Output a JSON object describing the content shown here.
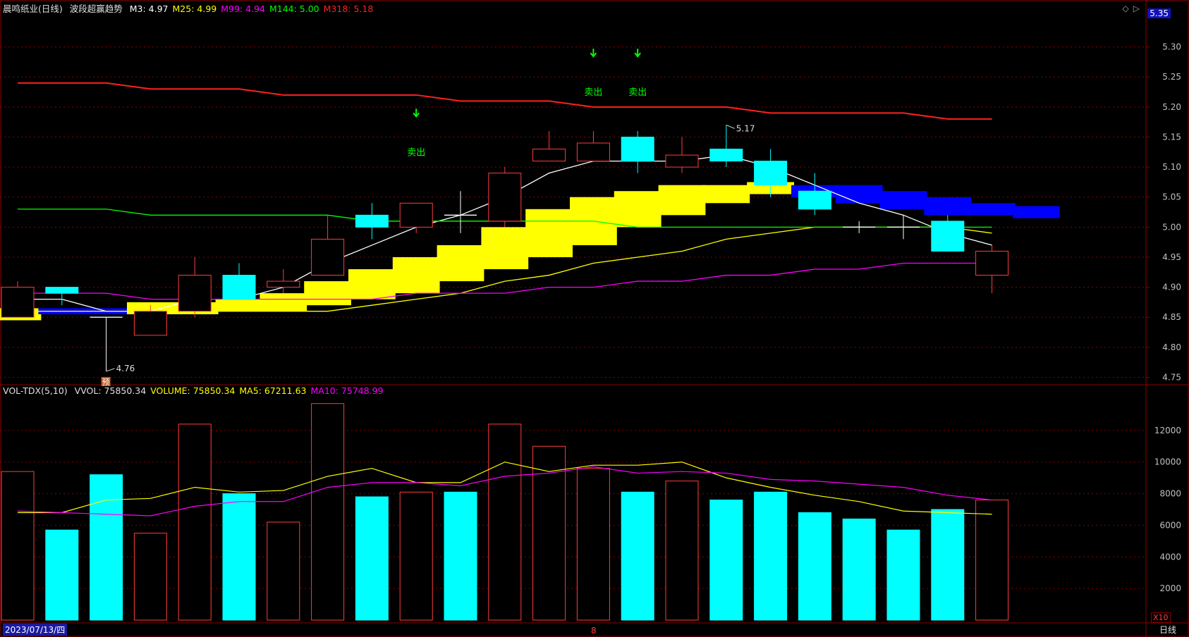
{
  "header_price": {
    "stock": "晨鸣纸业(日线)",
    "indicator": "波段超赢趋势",
    "ma": [
      {
        "label": "M3:",
        "value": "4.97",
        "color": "#ffffff"
      },
      {
        "label": "M25:",
        "value": "4.99",
        "color": "#ffff00"
      },
      {
        "label": "M99:",
        "value": "4.94",
        "color": "#ff00ff"
      },
      {
        "label": "M144:",
        "value": "5.00",
        "color": "#00ff00"
      },
      {
        "label": "M318:",
        "value": "5.18",
        "color": "#ff2020"
      }
    ]
  },
  "header_vol": {
    "name": "VOL-TDX(5,10)",
    "items": [
      {
        "label": "VVOL:",
        "value": "75850.34",
        "color": "#e0e0e0"
      },
      {
        "label": "VOLUME:",
        "value": "75850.34",
        "color": "#ffff00"
      },
      {
        "label": "MA5:",
        "value": "67211.63",
        "color": "#ffff00"
      },
      {
        "label": "MA10:",
        "value": "75748.99",
        "color": "#ff00ff"
      }
    ]
  },
  "axis_top_value": "5.35",
  "vol_unit": "X10",
  "date_label": "2023/07/13/四",
  "period_label": "日线",
  "bottom_marker": "8",
  "high_label": "5.17",
  "low_label": "4.76",
  "pre_label": "预",
  "sell_label": "卖出",
  "colors": {
    "up": "#ff3c3c",
    "down": "#00ffff",
    "m3": "#ffffff",
    "m25": "#ffff00",
    "m99": "#ff00ff",
    "m144": "#00ff00",
    "m318": "#ff2020",
    "band_up": "#ffff00",
    "band_down": "#0000ff",
    "grid": "#8b0000",
    "axis": "#c0c0c0",
    "sell": "#00ff00"
  },
  "chart_data": [
    {
      "type": "candlestick",
      "title": "晨鸣纸业(日线)",
      "ylim": [
        4.74,
        5.35
      ],
      "y_ticks": [
        4.75,
        4.8,
        4.85,
        4.9,
        4.95,
        5.0,
        5.05,
        5.1,
        5.15,
        5.2,
        5.25,
        5.3
      ],
      "candles": [
        {
          "o": 4.85,
          "h": 4.91,
          "l": 4.85,
          "c": 4.9
        },
        {
          "o": 4.9,
          "h": 4.9,
          "l": 4.87,
          "c": 4.89
        },
        {
          "o": 4.85,
          "h": 4.85,
          "l": 4.76,
          "c": 4.85
        },
        {
          "o": 4.82,
          "h": 4.87,
          "l": 4.82,
          "c": 4.86
        },
        {
          "o": 4.86,
          "h": 4.95,
          "l": 4.85,
          "c": 4.92
        },
        {
          "o": 4.92,
          "h": 4.94,
          "l": 4.88,
          "c": 4.88
        },
        {
          "o": 4.9,
          "h": 4.93,
          "l": 4.89,
          "c": 4.91
        },
        {
          "o": 4.92,
          "h": 5.02,
          "l": 4.92,
          "c": 4.98
        },
        {
          "o": 5.02,
          "h": 5.04,
          "l": 4.98,
          "c": 5.0
        },
        {
          "o": 5.0,
          "h": 5.04,
          "l": 4.99,
          "c": 5.04
        },
        {
          "o": 5.02,
          "h": 5.06,
          "l": 4.99,
          "c": 5.02
        },
        {
          "o": 5.01,
          "h": 5.1,
          "l": 5.0,
          "c": 5.09
        },
        {
          "o": 5.11,
          "h": 5.16,
          "l": 5.11,
          "c": 5.13
        },
        {
          "o": 5.11,
          "h": 5.16,
          "l": 5.11,
          "c": 5.14
        },
        {
          "o": 5.15,
          "h": 5.16,
          "l": 5.09,
          "c": 5.11
        },
        {
          "o": 5.1,
          "h": 5.15,
          "l": 5.09,
          "c": 5.12
        },
        {
          "o": 5.13,
          "h": 5.17,
          "l": 5.1,
          "c": 5.11
        },
        {
          "o": 5.11,
          "h": 5.13,
          "l": 5.05,
          "c": 5.07
        },
        {
          "o": 5.06,
          "h": 5.09,
          "l": 5.02,
          "c": 5.03
        },
        {
          "o": 5.0,
          "h": 5.01,
          "l": 4.99,
          "c": 5.0
        },
        {
          "o": 5.0,
          "h": 5.02,
          "l": 4.98,
          "c": 5.0
        },
        {
          "o": 5.01,
          "h": 5.02,
          "l": 4.96,
          "c": 4.96
        },
        {
          "o": 4.92,
          "h": 4.97,
          "l": 4.89,
          "c": 4.96
        }
      ],
      "ma_series": {
        "M3": [
          4.88,
          4.88,
          4.86,
          4.86,
          4.88,
          4.88,
          4.9,
          4.94,
          4.97,
          5.0,
          5.02,
          5.05,
          5.09,
          5.11,
          5.11,
          5.11,
          5.12,
          5.1,
          5.07,
          5.04,
          5.02,
          4.99,
          4.97
        ],
        "M25": [
          4.86,
          4.86,
          4.86,
          4.86,
          4.86,
          4.86,
          4.86,
          4.86,
          4.87,
          4.88,
          4.89,
          4.91,
          4.92,
          4.94,
          4.95,
          4.96,
          4.98,
          4.99,
          5.0,
          5.0,
          5.0,
          5.0,
          4.99
        ],
        "M99": [
          4.89,
          4.89,
          4.89,
          4.88,
          4.88,
          4.88,
          4.88,
          4.88,
          4.88,
          4.89,
          4.89,
          4.89,
          4.9,
          4.9,
          4.91,
          4.91,
          4.92,
          4.92,
          4.93,
          4.93,
          4.94,
          4.94,
          4.94
        ],
        "M144": [
          5.03,
          5.03,
          5.03,
          5.02,
          5.02,
          5.02,
          5.02,
          5.02,
          5.01,
          5.01,
          5.01,
          5.01,
          5.01,
          5.01,
          5.0,
          5.0,
          5.0,
          5.0,
          5.0,
          5.0,
          5.0,
          5.0,
          5.0
        ],
        "M318": [
          5.24,
          5.24,
          5.24,
          5.23,
          5.23,
          5.23,
          5.22,
          5.22,
          5.22,
          5.22,
          5.21,
          5.21,
          5.21,
          5.2,
          5.2,
          5.2,
          5.2,
          5.19,
          5.19,
          5.19,
          5.19,
          5.18,
          5.18
        ]
      },
      "trend_band": [
        {
          "lo": 4.85,
          "hi": 4.86,
          "dir": "mixed"
        },
        {
          "lo": 4.86,
          "hi": 4.86,
          "dir": "down"
        },
        {
          "lo": 4.86,
          "hi": 4.86,
          "dir": "down"
        },
        {
          "lo": 4.86,
          "hi": 4.87,
          "dir": "up"
        },
        {
          "lo": 4.86,
          "hi": 4.87,
          "dir": "up"
        },
        {
          "lo": 4.86,
          "hi": 4.88,
          "dir": "up"
        },
        {
          "lo": 4.86,
          "hi": 4.89,
          "dir": "up"
        },
        {
          "lo": 4.87,
          "hi": 4.91,
          "dir": "up"
        },
        {
          "lo": 4.88,
          "hi": 4.93,
          "dir": "up"
        },
        {
          "lo": 4.89,
          "hi": 4.95,
          "dir": "up"
        },
        {
          "lo": 4.91,
          "hi": 4.97,
          "dir": "up"
        },
        {
          "lo": 4.93,
          "hi": 5.0,
          "dir": "up"
        },
        {
          "lo": 4.95,
          "hi": 5.03,
          "dir": "up"
        },
        {
          "lo": 4.97,
          "hi": 5.05,
          "dir": "up"
        },
        {
          "lo": 5.0,
          "hi": 5.06,
          "dir": "up"
        },
        {
          "lo": 5.02,
          "hi": 5.07,
          "dir": "up"
        },
        {
          "lo": 5.04,
          "hi": 5.07,
          "dir": "up"
        },
        {
          "lo": 5.06,
          "hi": 5.07,
          "dir": "up"
        },
        {
          "lo": 5.05,
          "hi": 5.07,
          "dir": "down"
        },
        {
          "lo": 5.04,
          "hi": 5.07,
          "dir": "down"
        },
        {
          "lo": 5.03,
          "hi": 5.06,
          "dir": "down"
        },
        {
          "lo": 5.02,
          "hi": 5.05,
          "dir": "down"
        },
        {
          "lo": 5.02,
          "hi": 5.04,
          "dir": "down"
        },
        {
          "lo": 5.02,
          "hi": 5.03,
          "dir": "down"
        }
      ],
      "sell_signals": [
        {
          "index": 9,
          "price": 5.19
        },
        {
          "index": 13,
          "price": 5.29
        },
        {
          "index": 14,
          "price": 5.29
        }
      ],
      "high_point": {
        "index": 16,
        "price": 5.17,
        "label": "5.17"
      },
      "low_point": {
        "index": 2,
        "price": 4.76,
        "label": "4.76"
      }
    },
    {
      "type": "bar",
      "title": "VOL-TDX(5,10)",
      "unit": "X10",
      "ylim": [
        0,
        14000
      ],
      "y_ticks": [
        2000,
        4000,
        6000,
        8000,
        10000,
        12000
      ],
      "volumes": [
        9400,
        5700,
        9200,
        5500,
        12400,
        8000,
        6200,
        13700,
        7800,
        8100,
        8100,
        12400,
        11000,
        9600,
        8100,
        8800,
        7600,
        8100,
        6800,
        6400,
        5700,
        7000,
        7600
      ],
      "up": [
        true,
        false,
        false,
        true,
        true,
        false,
        true,
        true,
        false,
        true,
        false,
        true,
        true,
        true,
        false,
        true,
        false,
        false,
        false,
        false,
        false,
        false,
        true
      ],
      "MA5": [
        6800,
        6800,
        7600,
        7700,
        8400,
        8100,
        8200,
        9100,
        9600,
        8700,
        8700,
        10000,
        9400,
        9800,
        9800,
        10000,
        9000,
        8400,
        7900,
        7500,
        6900,
        6800,
        6700
      ],
      "MA10": [
        6900,
        6800,
        6700,
        6600,
        7200,
        7500,
        7500,
        8400,
        8700,
        8700,
        8500,
        9100,
        9300,
        9700,
        9300,
        9400,
        9300,
        8900,
        8800,
        8600,
        8400,
        7900,
        7600
      ]
    }
  ]
}
